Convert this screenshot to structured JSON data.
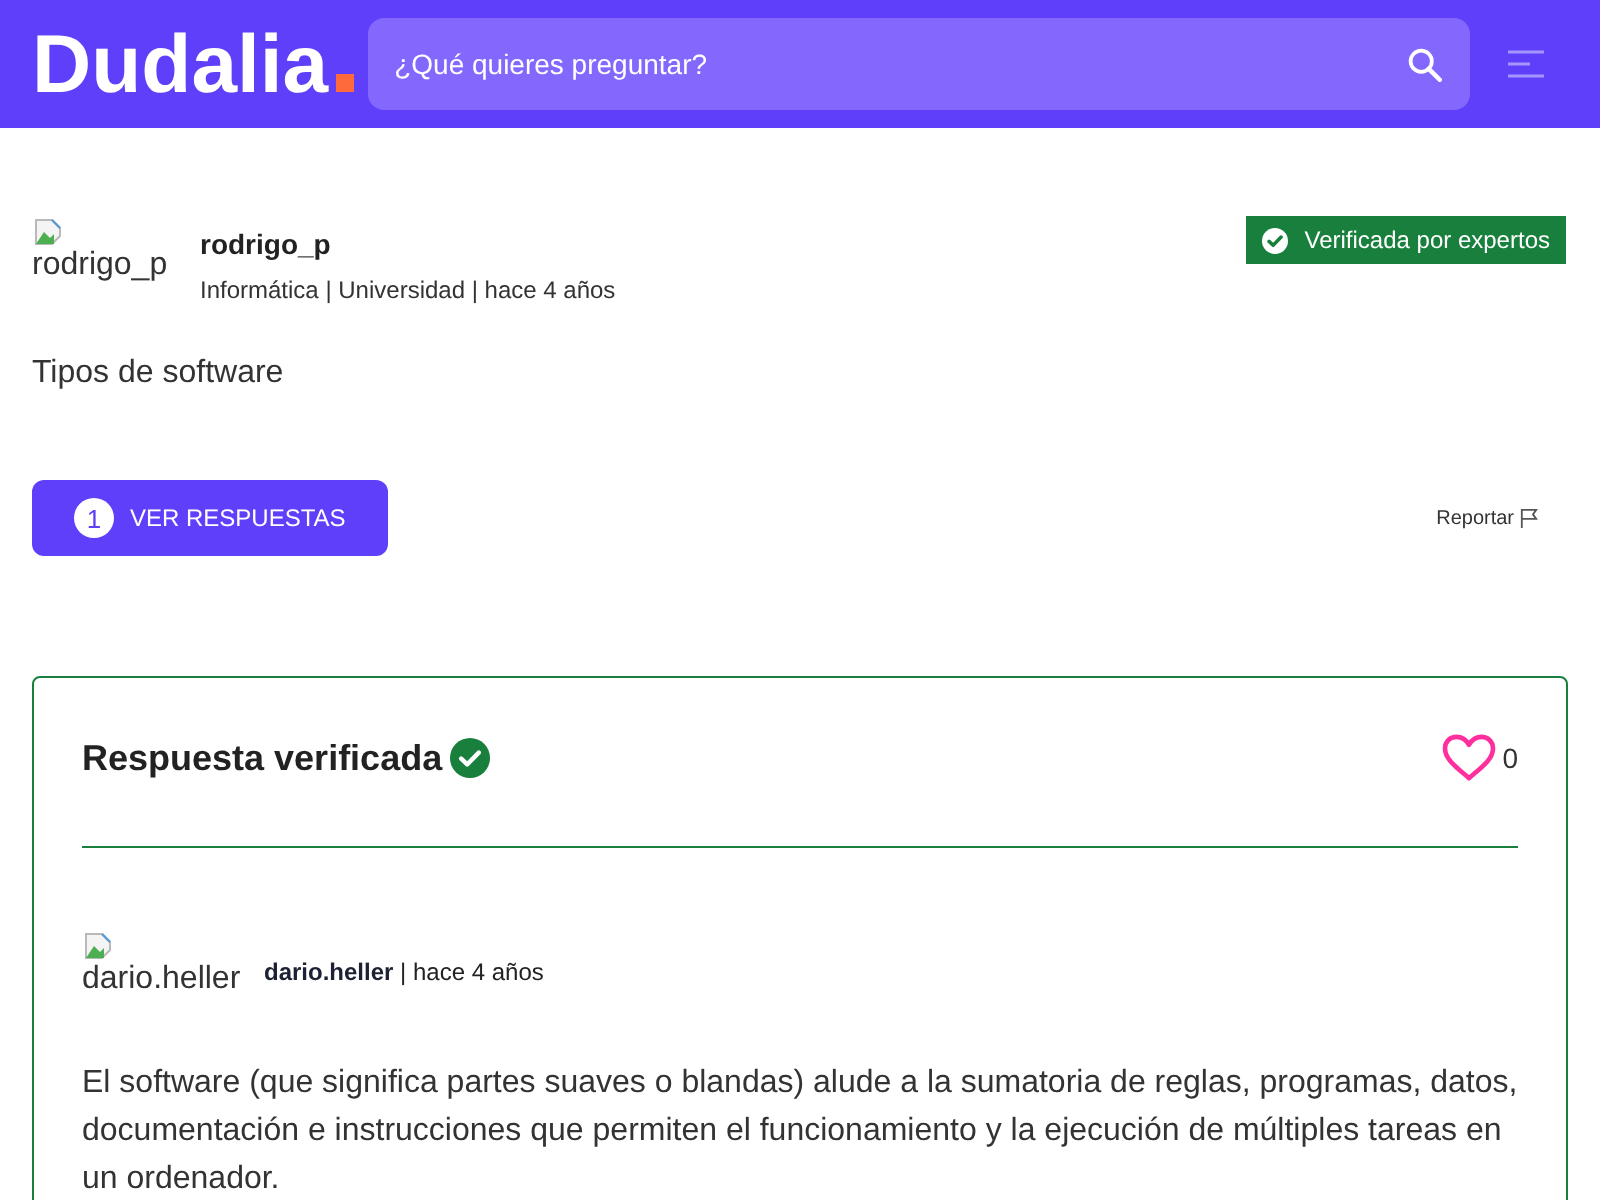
{
  "header": {
    "logo": "Dudalia",
    "search": {
      "placeholder": "¿Qué quieres preguntar?"
    }
  },
  "question": {
    "author": {
      "avatar_alt": "rodrigo_p",
      "name": "rodrigo_p",
      "meta": "Informática | Universidad | hace 4 años"
    },
    "badge": "Verificada por expertos",
    "text": "Tipos de software",
    "answers_button": {
      "count": "1",
      "label": "VER RESPUESTAS"
    },
    "report": "Reportar"
  },
  "answer": {
    "title": "Respuesta verificada",
    "verified": true,
    "likes": "0",
    "author": {
      "avatar_alt": "dario.heller",
      "name": "dario.heller",
      "meta": "| hace 4 años"
    },
    "text": "El software (que significa partes suaves o blandas) alude a la sumatoria de reglas, programas, datos, documentación e instrucciones que permiten el funcionamiento y la ejecución de múltiples tareas en un ordenador."
  }
}
